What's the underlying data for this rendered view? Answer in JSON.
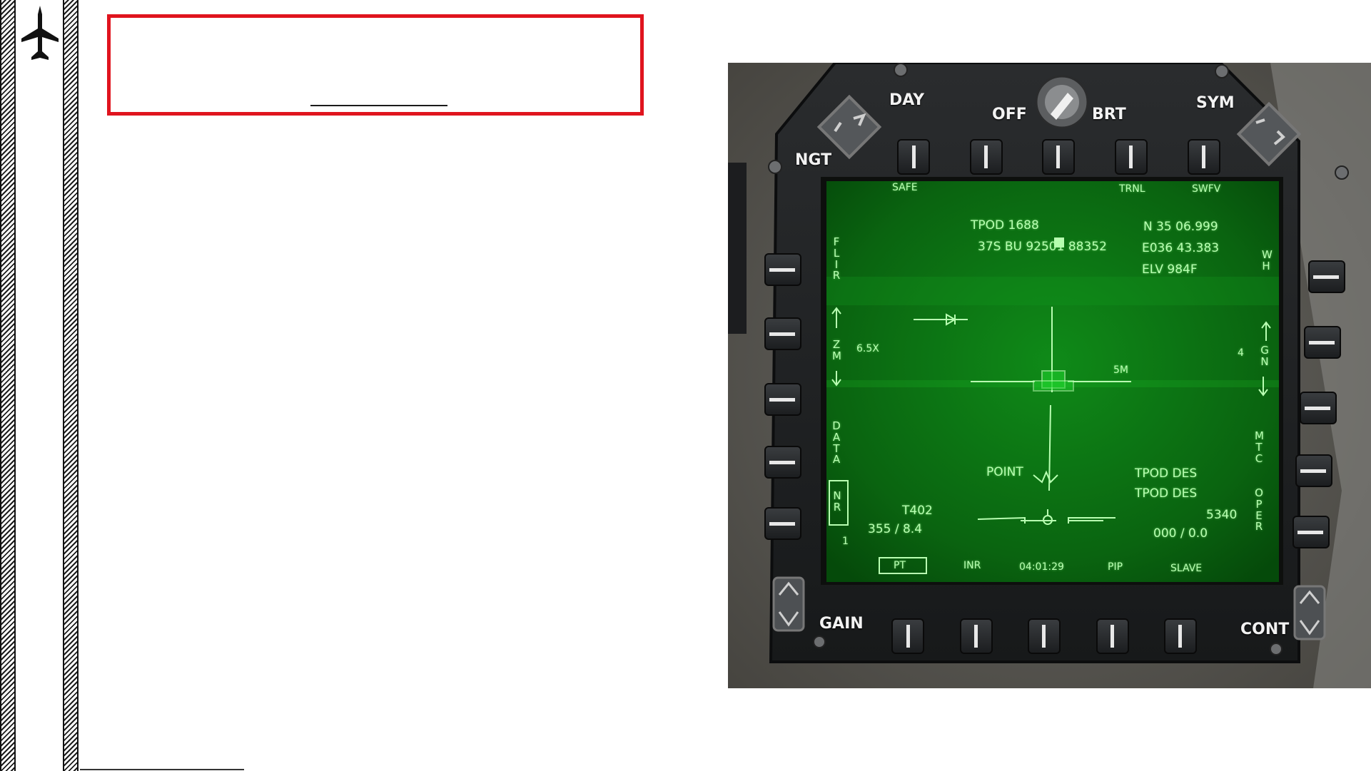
{
  "title_box": {
    "title": "",
    "accent": "#e0141e"
  },
  "mfd": {
    "bezel": {
      "top_left": "DAY",
      "knob_left": "OFF",
      "knob_right": "BRT",
      "top_right": "SYM",
      "left_upper": "NGT",
      "bottom_left": "GAIN",
      "bottom_right": "CONT"
    },
    "display": {
      "top_labels": [
        "SAFE",
        "TRNL",
        "SWFV"
      ],
      "left_labels": [
        "FLIR",
        "ZM",
        "DATA",
        "NR"
      ],
      "right_labels": [
        "WH",
        "GN",
        "MTC",
        "OPER"
      ],
      "header_line1": "TPOD 1688",
      "header_line2": "37S BU 92501 88352",
      "coord_lat": "N 35 06.999",
      "coord_lon": "E036 43.383",
      "coord_elv": "ELV    984F",
      "zoom": "6.5X",
      "range_mark": "5M",
      "gain_value": "4",
      "mode": "POINT",
      "designation_1": "TPOD DES",
      "designation_2": "TPOD DES",
      "target_id": "T402",
      "target_bearing": "355 / 8.4",
      "range_value": "5340",
      "offset_value": "000 / 0.0",
      "nr_level": "1",
      "bottom_labels": [
        "PT",
        "INR",
        "04:01:29",
        "PIP",
        "SLAVE"
      ]
    },
    "colors": {
      "symbology": "#b9ffb2",
      "screen": "#0b6a12",
      "bezel": "#1f2123"
    }
  },
  "icons": {
    "rail_emblem": "jet-aircraft-icon"
  }
}
